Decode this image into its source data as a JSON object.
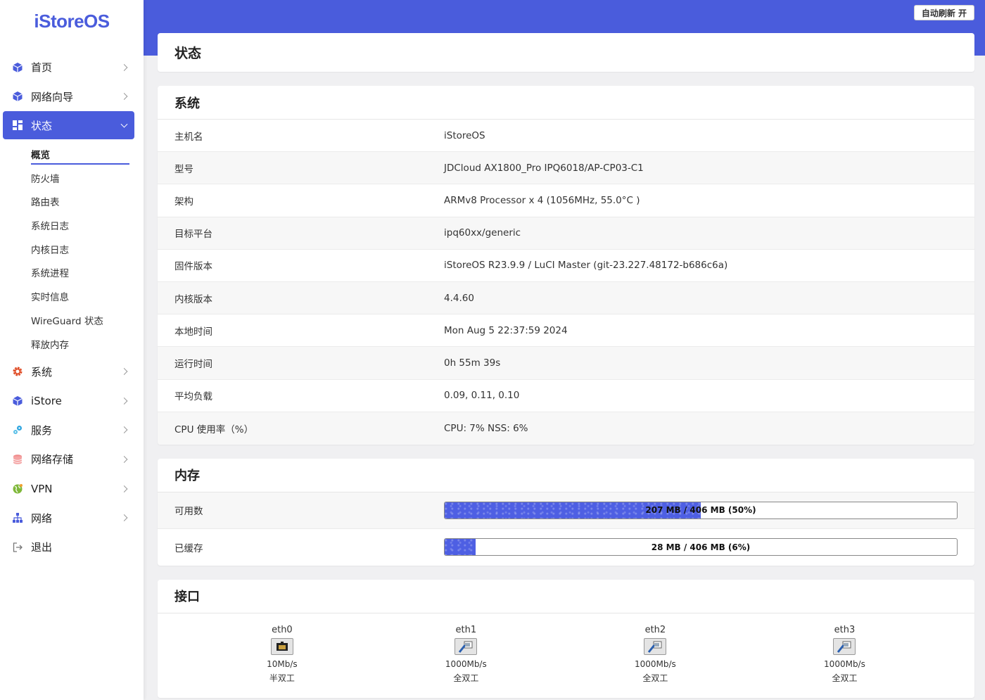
{
  "brand": "iStoreOS",
  "header": {
    "refresh_label": "自动刷新 开"
  },
  "page_title": "状态",
  "menu": {
    "home": "首页",
    "wizard": "网络向导",
    "status": "状态",
    "status_sub": [
      "概览",
      "防火墙",
      "路由表",
      "系统日志",
      "内核日志",
      "系统进程",
      "实时信息",
      "WireGuard 状态",
      "释放内存"
    ],
    "system": "系统",
    "istore": "iStore",
    "services": "服务",
    "nas": "网络存储",
    "vpn": "VPN",
    "network": "网络",
    "logout": "退出"
  },
  "system": {
    "title": "系统",
    "rows": [
      {
        "k": "主机名",
        "v": "iStoreOS"
      },
      {
        "k": "型号",
        "v": "JDCloud AX1800_Pro IPQ6018/AP-CP03-C1"
      },
      {
        "k": "架构",
        "v": "ARMv8 Processor x 4 (1056MHz, 55.0°C )"
      },
      {
        "k": "目标平台",
        "v": "ipq60xx/generic"
      },
      {
        "k": "固件版本",
        "v": "iStoreOS R23.9.9 / LuCI Master (git-23.227.48172-b686c6a)"
      },
      {
        "k": "内核版本",
        "v": "4.4.60"
      },
      {
        "k": "本地时间",
        "v": "Mon Aug 5 22:37:59 2024"
      },
      {
        "k": "运行时间",
        "v": "0h 55m 39s"
      },
      {
        "k": "平均负载",
        "v": "0.09, 0.11, 0.10"
      },
      {
        "k": "CPU 使用率（%）",
        "v": "CPU: 7% NSS: 6%"
      }
    ]
  },
  "memory": {
    "title": "内存",
    "available": {
      "label": "可用数",
      "text": "207 MB / 406 MB (50%)",
      "percent": 50
    },
    "cached": {
      "label": "已缓存",
      "text": "28 MB / 406 MB (6%)",
      "percent": 6
    }
  },
  "interfaces": {
    "title": "接口",
    "items": [
      {
        "name": "eth0",
        "speed": "10Mb/s",
        "duplex": "半双工"
      },
      {
        "name": "eth1",
        "speed": "1000Mb/s",
        "duplex": "全双工"
      },
      {
        "name": "eth2",
        "speed": "1000Mb/s",
        "duplex": "全双工"
      },
      {
        "name": "eth3",
        "speed": "1000Mb/s",
        "duplex": "全双工"
      }
    ]
  },
  "colors": {
    "accent": "#4a5cdc"
  }
}
